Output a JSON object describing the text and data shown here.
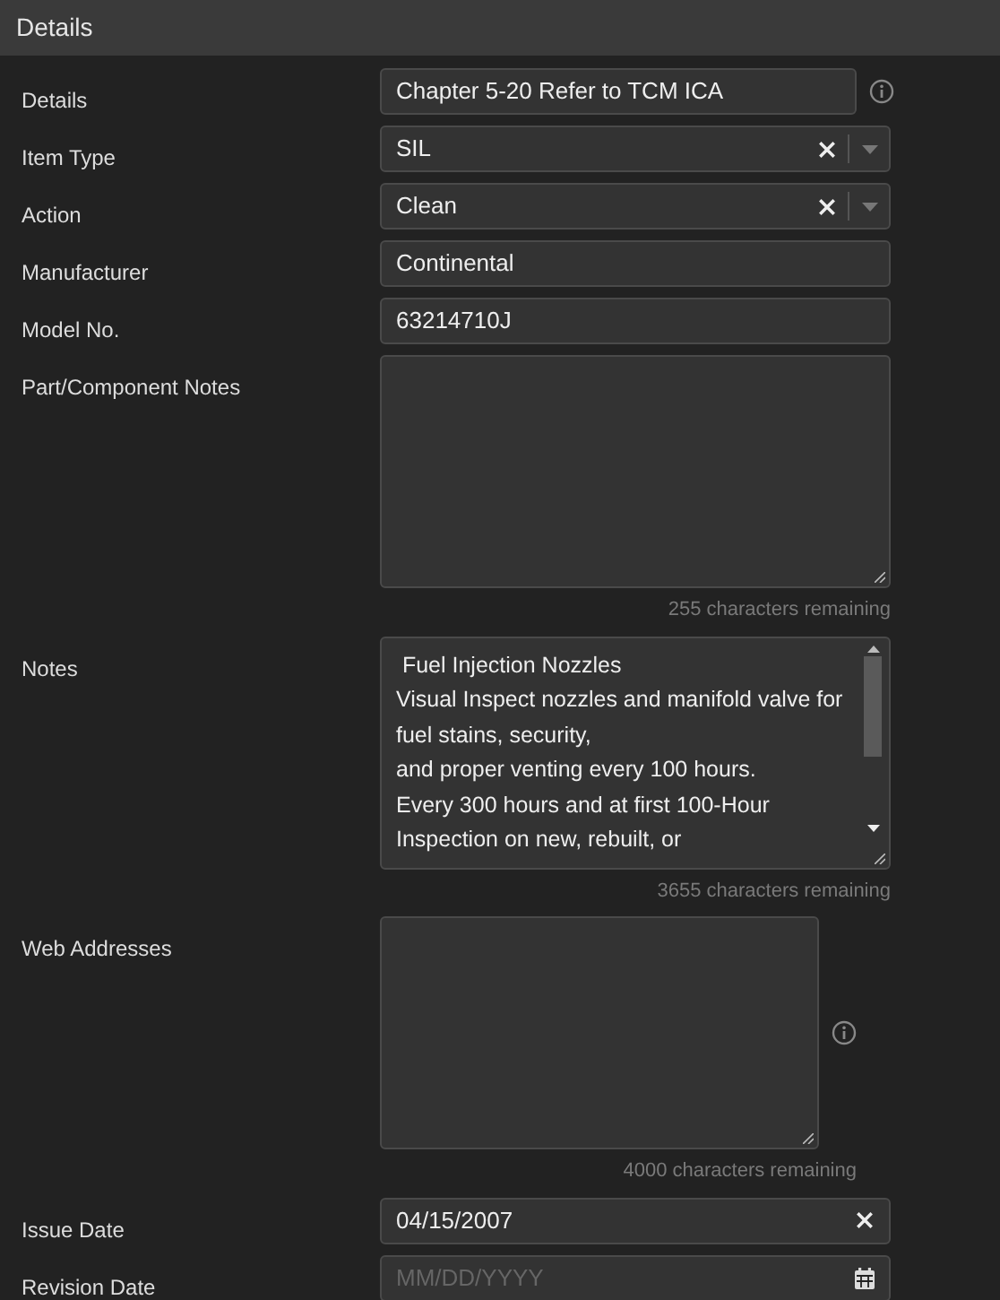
{
  "panel": {
    "title": "Details"
  },
  "fields": [
    {
      "kind": "text",
      "label": "Details",
      "value": "Chapter 5-20 Refer to TCM ICA",
      "info": true
    },
    {
      "kind": "select",
      "label": "Item Type",
      "value": "SIL"
    },
    {
      "kind": "select",
      "label": "Action",
      "value": "Clean"
    },
    {
      "kind": "text",
      "label": "Manufacturer",
      "value": "Continental",
      "info": false
    },
    {
      "kind": "text",
      "label": "Model No.",
      "value": "63214710J",
      "info": false
    },
    {
      "kind": "textarea",
      "label": "Part/Component Notes",
      "counter": "255 characters remaining",
      "info": false,
      "scrollbar": false
    },
    {
      "kind": "textarea",
      "label": "Notes",
      "lines": [
        " Fuel Injection Nozzles",
        "Visual Inspect nozzles and manifold valve for",
        "fuel stains, security,",
        "and proper venting every 100 hours.",
        "Every 300 hours and at first 100-Hour",
        "Inspection on new, rebuilt, or"
      ],
      "counter": "3655 characters remaining",
      "info": false,
      "scrollbar": true
    },
    {
      "kind": "textarea",
      "label": "Web Addresses",
      "counter": "4000 characters remaining",
      "info": true,
      "scrollbar": false
    },
    {
      "kind": "date",
      "label": "Issue Date",
      "value": "04/15/2007"
    },
    {
      "kind": "date",
      "label": "Revision Date",
      "placeholder": "MM/DD/YYYY"
    }
  ]
}
